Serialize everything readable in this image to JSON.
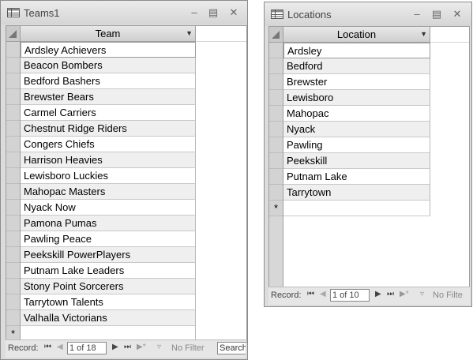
{
  "teams_window": {
    "title": "Teams1",
    "column_header": "Team",
    "rows": [
      "Ardsley Achievers",
      "Beacon Bombers",
      "Bedford Bashers",
      "Brewster Bears",
      "Carmel Carriers",
      "Chestnut Ridge Riders",
      "Congers Chiefs",
      "Harrison Heavies",
      "Lewisboro Luckies",
      "Mahopac Masters",
      "Nyack Now",
      "Pamona Pumas",
      "Pawling Peace",
      "Peekskill PowerPlayers",
      "Putnam Lake Leaders",
      "Stony Point Sorcerers",
      "Tarrytown Talents",
      "Valhalla Victorians"
    ],
    "new_row_marker": "*",
    "nav": {
      "record_label": "Record:",
      "position": "1 of 18",
      "filter_label": "No Filter",
      "search_label": "Search"
    }
  },
  "locations_window": {
    "title": "Locations",
    "column_header": "Location",
    "rows": [
      "Ardsley",
      "Bedford",
      "Brewster",
      "Lewisboro",
      "Mahopac",
      "Nyack",
      "Pawling",
      "Peekskill",
      "Putnam Lake",
      "Tarrytown"
    ],
    "new_row_marker": "*",
    "nav": {
      "record_label": "Record:",
      "position": "1 of 10",
      "filter_label": "No Filte"
    }
  },
  "icons": {
    "minimize": "minimize-icon",
    "maximize": "maximize-icon",
    "close": "close-icon",
    "table": "table-icon"
  }
}
